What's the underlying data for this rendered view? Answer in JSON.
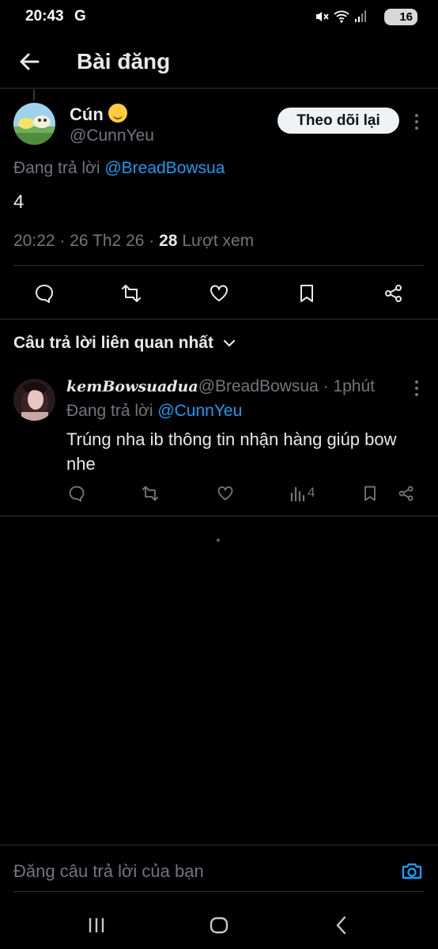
{
  "status_bar": {
    "time": "20:43",
    "carrier_icon": "G",
    "battery": "16"
  },
  "header": {
    "title": "Bài đăng"
  },
  "post": {
    "author_name": "Cún",
    "author_handle": "@CunnYeu",
    "follow_label": "Theo dõi lại",
    "reply_prefix": "Đang trả lời",
    "reply_mention": "@BreadBowsua",
    "text": "4",
    "time": "20:22",
    "date": "26 Th2 26",
    "views": "28",
    "views_label": "Lượt xem"
  },
  "section": {
    "title": "Câu trả lời liên quan nhất"
  },
  "reply": {
    "display_name": "kemBowsuadua",
    "handle": "@BreadBowsua",
    "time": "1phút",
    "reply_prefix": "Đang trả lời",
    "reply_mention": "@CunnYeu",
    "text": "Trúng nha ib thông tin nhận hàng giúp bow nhe",
    "views": "4"
  },
  "composer": {
    "placeholder": "Đăng câu trả lời của bạn"
  },
  "colors": {
    "accent": "#1d9bf0",
    "background": "#000000",
    "secondary_text": "#71767b",
    "divider": "#2f3336"
  }
}
